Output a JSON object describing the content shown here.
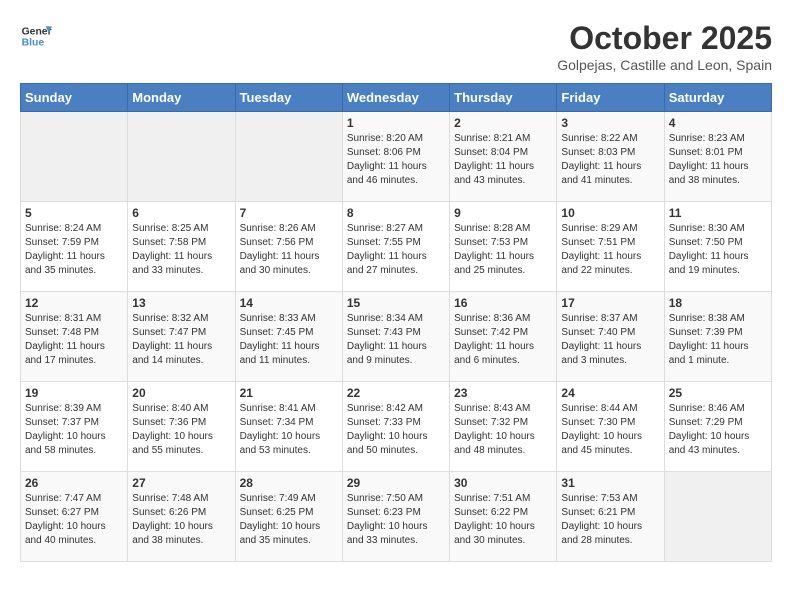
{
  "header": {
    "logo_line1": "General",
    "logo_line2": "Blue",
    "month": "October 2025",
    "location": "Golpejas, Castille and Leon, Spain"
  },
  "days_of_week": [
    "Sunday",
    "Monday",
    "Tuesday",
    "Wednesday",
    "Thursday",
    "Friday",
    "Saturday"
  ],
  "weeks": [
    [
      {
        "day": "",
        "info": ""
      },
      {
        "day": "",
        "info": ""
      },
      {
        "day": "",
        "info": ""
      },
      {
        "day": "1",
        "info": "Sunrise: 8:20 AM\nSunset: 8:06 PM\nDaylight: 11 hours and 46 minutes."
      },
      {
        "day": "2",
        "info": "Sunrise: 8:21 AM\nSunset: 8:04 PM\nDaylight: 11 hours and 43 minutes."
      },
      {
        "day": "3",
        "info": "Sunrise: 8:22 AM\nSunset: 8:03 PM\nDaylight: 11 hours and 41 minutes."
      },
      {
        "day": "4",
        "info": "Sunrise: 8:23 AM\nSunset: 8:01 PM\nDaylight: 11 hours and 38 minutes."
      }
    ],
    [
      {
        "day": "5",
        "info": "Sunrise: 8:24 AM\nSunset: 7:59 PM\nDaylight: 11 hours and 35 minutes."
      },
      {
        "day": "6",
        "info": "Sunrise: 8:25 AM\nSunset: 7:58 PM\nDaylight: 11 hours and 33 minutes."
      },
      {
        "day": "7",
        "info": "Sunrise: 8:26 AM\nSunset: 7:56 PM\nDaylight: 11 hours and 30 minutes."
      },
      {
        "day": "8",
        "info": "Sunrise: 8:27 AM\nSunset: 7:55 PM\nDaylight: 11 hours and 27 minutes."
      },
      {
        "day": "9",
        "info": "Sunrise: 8:28 AM\nSunset: 7:53 PM\nDaylight: 11 hours and 25 minutes."
      },
      {
        "day": "10",
        "info": "Sunrise: 8:29 AM\nSunset: 7:51 PM\nDaylight: 11 hours and 22 minutes."
      },
      {
        "day": "11",
        "info": "Sunrise: 8:30 AM\nSunset: 7:50 PM\nDaylight: 11 hours and 19 minutes."
      }
    ],
    [
      {
        "day": "12",
        "info": "Sunrise: 8:31 AM\nSunset: 7:48 PM\nDaylight: 11 hours and 17 minutes."
      },
      {
        "day": "13",
        "info": "Sunrise: 8:32 AM\nSunset: 7:47 PM\nDaylight: 11 hours and 14 minutes."
      },
      {
        "day": "14",
        "info": "Sunrise: 8:33 AM\nSunset: 7:45 PM\nDaylight: 11 hours and 11 minutes."
      },
      {
        "day": "15",
        "info": "Sunrise: 8:34 AM\nSunset: 7:43 PM\nDaylight: 11 hours and 9 minutes."
      },
      {
        "day": "16",
        "info": "Sunrise: 8:36 AM\nSunset: 7:42 PM\nDaylight: 11 hours and 6 minutes."
      },
      {
        "day": "17",
        "info": "Sunrise: 8:37 AM\nSunset: 7:40 PM\nDaylight: 11 hours and 3 minutes."
      },
      {
        "day": "18",
        "info": "Sunrise: 8:38 AM\nSunset: 7:39 PM\nDaylight: 11 hours and 1 minute."
      }
    ],
    [
      {
        "day": "19",
        "info": "Sunrise: 8:39 AM\nSunset: 7:37 PM\nDaylight: 10 hours and 58 minutes."
      },
      {
        "day": "20",
        "info": "Sunrise: 8:40 AM\nSunset: 7:36 PM\nDaylight: 10 hours and 55 minutes."
      },
      {
        "day": "21",
        "info": "Sunrise: 8:41 AM\nSunset: 7:34 PM\nDaylight: 10 hours and 53 minutes."
      },
      {
        "day": "22",
        "info": "Sunrise: 8:42 AM\nSunset: 7:33 PM\nDaylight: 10 hours and 50 minutes."
      },
      {
        "day": "23",
        "info": "Sunrise: 8:43 AM\nSunset: 7:32 PM\nDaylight: 10 hours and 48 minutes."
      },
      {
        "day": "24",
        "info": "Sunrise: 8:44 AM\nSunset: 7:30 PM\nDaylight: 10 hours and 45 minutes."
      },
      {
        "day": "25",
        "info": "Sunrise: 8:46 AM\nSunset: 7:29 PM\nDaylight: 10 hours and 43 minutes."
      }
    ],
    [
      {
        "day": "26",
        "info": "Sunrise: 7:47 AM\nSunset: 6:27 PM\nDaylight: 10 hours and 40 minutes."
      },
      {
        "day": "27",
        "info": "Sunrise: 7:48 AM\nSunset: 6:26 PM\nDaylight: 10 hours and 38 minutes."
      },
      {
        "day": "28",
        "info": "Sunrise: 7:49 AM\nSunset: 6:25 PM\nDaylight: 10 hours and 35 minutes."
      },
      {
        "day": "29",
        "info": "Sunrise: 7:50 AM\nSunset: 6:23 PM\nDaylight: 10 hours and 33 minutes."
      },
      {
        "day": "30",
        "info": "Sunrise: 7:51 AM\nSunset: 6:22 PM\nDaylight: 10 hours and 30 minutes."
      },
      {
        "day": "31",
        "info": "Sunrise: 7:53 AM\nSunset: 6:21 PM\nDaylight: 10 hours and 28 minutes."
      },
      {
        "day": "",
        "info": ""
      }
    ]
  ]
}
